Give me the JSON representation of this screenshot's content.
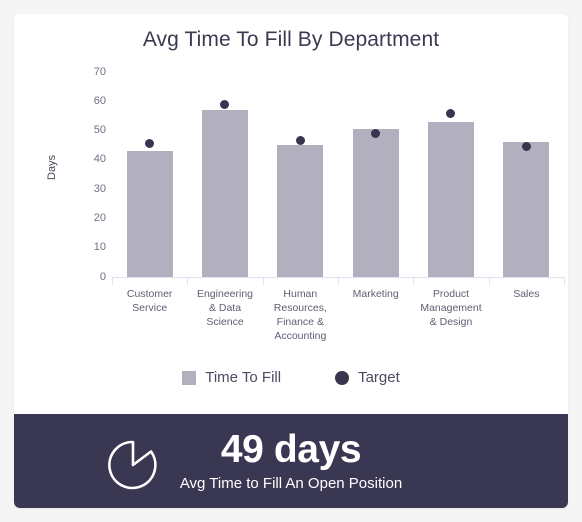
{
  "widget": {
    "background_color": "#ffffff",
    "page_background": "#f5f5f6"
  },
  "chart_data": {
    "type": "bar",
    "title": "Avg Time To Fill By Department",
    "xlabel": "",
    "ylabel": "Days",
    "ylim": [
      0,
      70
    ],
    "yticks": [
      "0",
      "10",
      "20",
      "30",
      "40",
      "50",
      "60",
      "70"
    ],
    "grid": false,
    "legend_position": "bottom",
    "categories": [
      "Customer Service",
      "Engineering & Data Science",
      "Human Resources, Finance & Accounting",
      "Marketing",
      "Product Management & Design",
      "Sales"
    ],
    "category_lines": [
      [
        "Customer",
        "Service"
      ],
      [
        "Engineering",
        "& Data",
        "Science"
      ],
      [
        "Human",
        "Resources,",
        "Finance &",
        "Accounting"
      ],
      [
        "Marketing"
      ],
      [
        "Product",
        "Management",
        "& Design"
      ],
      [
        "Sales"
      ]
    ],
    "series": [
      {
        "name": "Time To Fill",
        "type": "bar",
        "color": "#b2b0bf",
        "values": [
          43,
          57,
          45,
          50.5,
          53,
          46
        ]
      },
      {
        "name": "Target",
        "type": "scatter",
        "color": "#38354f",
        "values": [
          45.5,
          59,
          46.5,
          49,
          56,
          44.5
        ]
      }
    ]
  },
  "legend": {
    "items": [
      {
        "label": "Time To Fill",
        "marker": "square",
        "color": "#b2b0bf"
      },
      {
        "label": "Target",
        "marker": "circle",
        "color": "#38354f"
      }
    ]
  },
  "kpi": {
    "icon": "stopwatch-icon",
    "value": "49 days",
    "subtitle": "Avg Time to Fill An Open Position",
    "background_color": "#3a3752"
  }
}
